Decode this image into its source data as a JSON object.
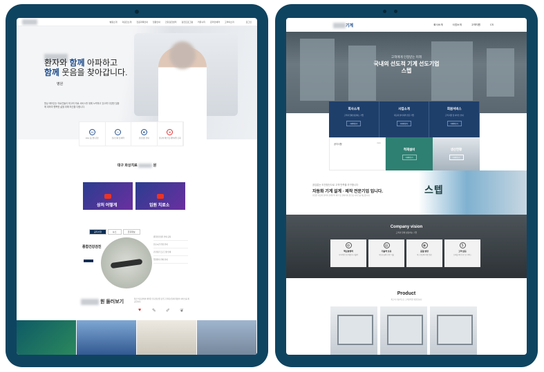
{
  "left_site": {
    "nav_items": [
      "병원소개",
      "의료진소개",
      "진료과목안내",
      "입원안내",
      "건강검진센터",
      "검진프로그램",
      "커뮤니티",
      "온라인예약",
      "고객의소리"
    ],
    "nav_right": "로그인",
    "hero_line1_a": "환자와 ",
    "hero_line1_b": "함께",
    "hero_line1_c": " 아파하고",
    "hero_line2_a": "함께",
    "hero_line2_b": " 웃음을 찾아갑니다.",
    "hero_name": "병원",
    "hero_desc": "항상 깨어있는 의료진들이 최고의 의료 서비스를 위해 노력하고 있으며 다양한 질환에 대하여 행복한 삶을 위해 최선을 다합니다.",
    "quick": [
      {
        "icon": "24",
        "label": "24시 응급실 운영"
      },
      {
        "icon": "+",
        "label": "진료안내 및 예약"
      },
      {
        "icon": "✚",
        "label": "건강검진 안내"
      },
      {
        "icon": "♥",
        "label": "진료비 확인 및 세부내역 조회"
      }
    ],
    "section_title": "대구 화상치료",
    "section_title_end": "원",
    "video1_text": "상처 어떻게",
    "video2_text": "입원 치료소",
    "tabs": [
      "공지사항",
      "뉴스",
      "건강정보"
    ],
    "checkup_title": "종합건강검진",
    "list_items": [
      "종합건강검진 안내 공지",
      "진료시간 변경 안내",
      "건강검진 프로그램 안내",
      "입원환자 면회 안내"
    ],
    "more_title": "원 둘러보기",
    "more_desc": "최신 의료장비와 쾌적한 진료환경을 갖추고 환자분들께 최상의 서비스를 제공합니다.",
    "icons": [
      "heart-icon",
      "pill-icon",
      "syringe-icon",
      "tooth-icon",
      "lung-icon"
    ]
  },
  "right_site": {
    "logo": "기계",
    "nav_items": [
      "회사소개",
      "사업소개",
      "고객지원",
      "CS"
    ],
    "hero_sub": "고객에게 인정받는 미래",
    "hero_title_line1": "국내의 선도적 기계 선도기업",
    "hero_title_line2": "스텝",
    "cards": [
      {
        "title": "회사소개",
        "desc": "고객과 함께 성장하는 기업",
        "btn": "자세히보기"
      },
      {
        "title": "사업소개",
        "desc": "자동화 설비 제작 전문 기업",
        "btn": "자세히보기"
      },
      {
        "title": "회원서비스",
        "desc": "고객 지원 및 서비스 안내",
        "btn": "자세히보기"
      }
    ],
    "notice_title": "공지사항",
    "notice_more": "more",
    "teal_title": "적재설비",
    "teal_btn": "자세히보기",
    "img_title": "생산현황",
    "img_btn": "자세히보기",
    "intro_sub": "끊임없는 도전정신으로 고객 만족을 추구합니다",
    "intro_title": "자동화 기계 설계 · 제작 전문기업 입니다.",
    "intro_desc": "다양한 자동화 설비의 설계부터 제작 및 설치까지 원스톱 서비스를 제공합니다.",
    "intro_sign": "스텝",
    "vision_title": "Company vision",
    "vision_sub": "고객과 함께 성장하는 기업",
    "vision_cards": [
      {
        "icon": "globe-icon",
        "glyph": "◍",
        "title": "핵심경쟁력",
        "desc": "지속적인 연구개발과 기술력"
      },
      {
        "icon": "doc-icon",
        "glyph": "▤",
        "title": "기술력 보유",
        "desc": "자동화 설비 전문 기술"
      },
      {
        "icon": "user-icon",
        "glyph": "◉",
        "title": "품질 경영",
        "desc": "최고 품질의 제품 생산"
      },
      {
        "icon": "money-icon",
        "glyph": "$",
        "title": "고객 감동",
        "desc": "신뢰를 바탕으로 한 서비스"
      }
    ],
    "product_title": "Product",
    "product_sub": "최고의 기술력으로 고객만족을 실현합니다"
  },
  "colors": {
    "frame": "#0f4460",
    "brand_blue": "#1f4d8c",
    "card_blue": "#1f3f6b",
    "teal": "#2e8072"
  }
}
